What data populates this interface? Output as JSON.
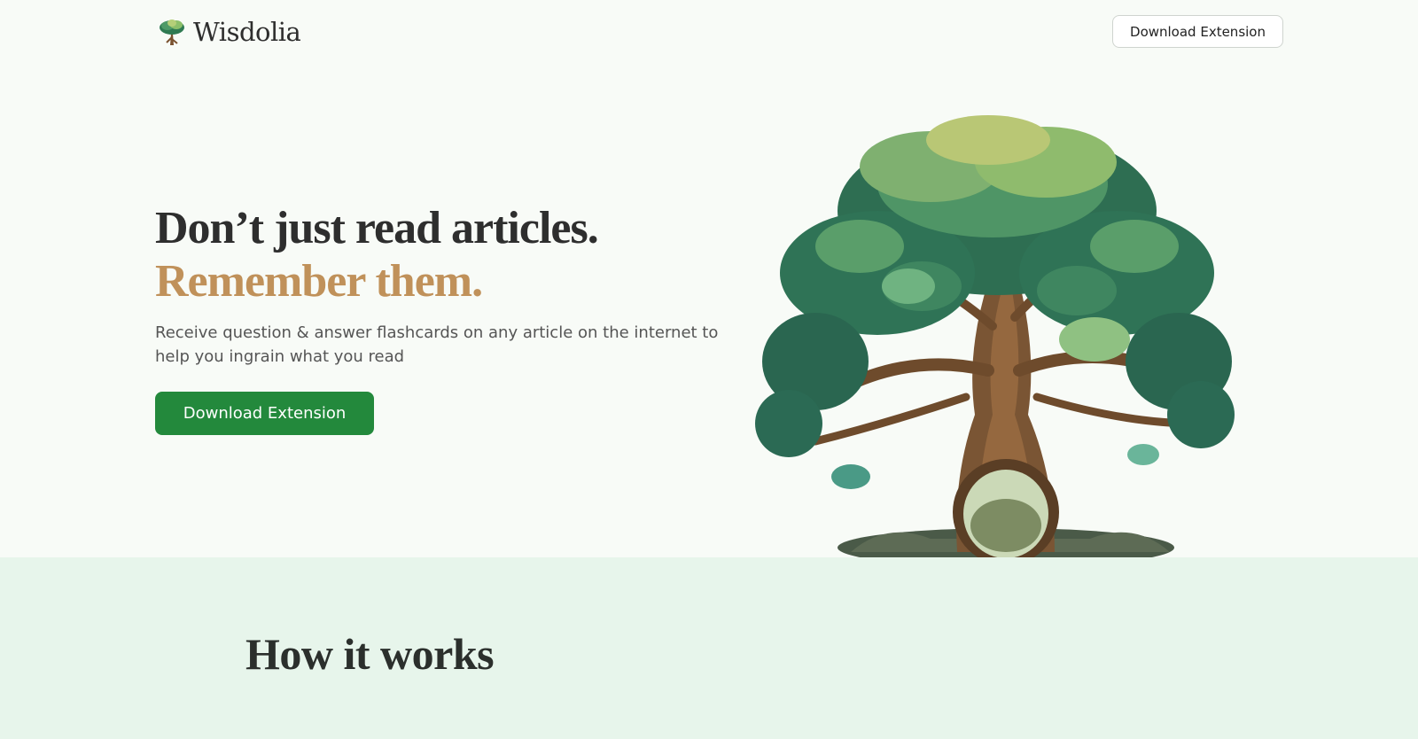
{
  "header": {
    "brand": "Wisdolia",
    "logo_icon": "tree-icon",
    "cta_label": "Download Extension"
  },
  "hero": {
    "title_line1": "Don’t just read articles.",
    "title_line2": "Remember them.",
    "subtitle": "Receive question & answer flashcards on any article on the internet to help you ingrain what you read",
    "cta_label": "Download Extension",
    "illustration": "tree-illustration"
  },
  "how_it_works": {
    "title": "How it works"
  },
  "colors": {
    "accent_green": "#23893c",
    "accent_gold": "#c0915a",
    "section_bg": "#e7f5eb",
    "page_bg": "#f8fbf7"
  }
}
